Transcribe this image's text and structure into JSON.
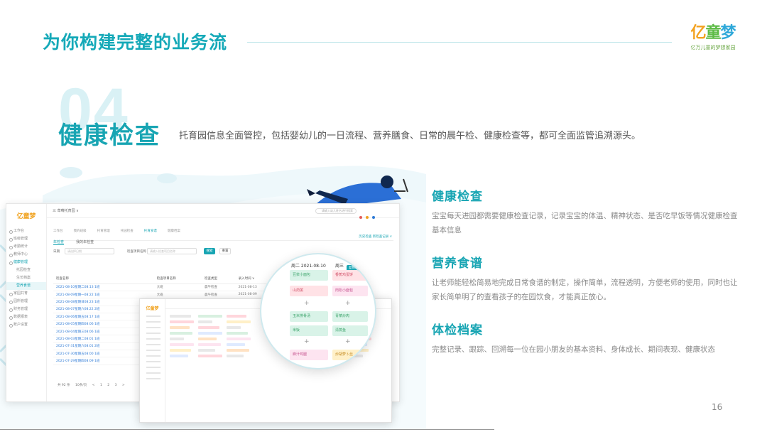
{
  "header": {
    "title": "为你构建完整的业务流",
    "logo": {
      "mark_part1": "亿",
      "mark_part2": "童",
      "mark_part3": "梦",
      "tagline": "亿万儿童的梦想家园"
    }
  },
  "section": {
    "number": "04",
    "title": "健康检查",
    "description": "托育园信息全面管控，包括婴幼儿的一日流程、营养膳食、日常的晨午检、健康检查等，都可全面监管追溯源头。"
  },
  "features": [
    {
      "title": "健康检查",
      "description": "宝宝每天进园都需要健康检查记录，记录宝宝的体温、精神状态、是否吃早饭等情况健康检查基本信息"
    },
    {
      "title": "营养食谱",
      "description": "让老师能轻松简易地完成日常食谱的制定，操作简单，流程透明，方便老师的使用，同时也让家长简单明了的查看孩子的在园饮食，才能真正放心。"
    },
    {
      "title": "体检档案",
      "description": "完整记录、跟踪、回溯每一位在园小朋友的基本资料、身体成长、期间表现、健康状态"
    }
  ],
  "page_number": "16",
  "mock_screen": {
    "logo": "亿童梦",
    "breadcrumb": "三 草莓托育园 ∨",
    "search_placeholder": "请输入幼儿姓名进行搜索",
    "sidebar": [
      "工作台",
      "班级管理",
      "考勤统计",
      "教师中心",
      "健康管理",
      "托园检查",
      "生长档案",
      "营养食谱",
      "家园共育",
      "园所管理",
      "财务管理",
      "数据报表",
      "账户设置"
    ],
    "top_tabs": [
      "工作台",
      "我的班级",
      "托育管理",
      "托园检查",
      "托育食谱",
      "健康档案"
    ],
    "sub_tabs": [
      "年检查",
      "我的年检查"
    ],
    "right_link": "历史检查  新检查记录 ∨",
    "filter": {
      "date_label": "日期",
      "date_placeholder": "请选择日期",
      "type_label": "检查项目名称",
      "type_placeholder": "请输入检查项目名称",
      "search_btn": "搜索",
      "reset_btn": "重置"
    },
    "table": {
      "headers": [
        "检查名称",
        "检查项目名称",
        "检查类型",
        "录入时间 ∨"
      ],
      "rows": [
        [
          "2021-08-10星期二08:13 1班",
          "大班",
          "晨午检查",
          "2021-08-13"
        ],
        [
          "2021-08-09星期一08:22 1班",
          "大班",
          "晨午检查",
          "2021-08-09"
        ],
        [
          "2021-08-08星期日08:23 1班",
          "小班",
          "晨午检查",
          "2021-08-08"
        ],
        [
          "2021-08-07星期六08:22 2班",
          "托班",
          "晨午检查",
          "2021-08-07"
        ],
        [
          "2021-08-06星期五08:17 1班",
          "中班",
          "晨午检查",
          "2021-08-06"
        ],
        [
          "2021-08-05星期四08:06 1班",
          "小班",
          "晨午检查",
          "2021-08-05"
        ],
        [
          "2021-08-04星期三08:06 1班",
          "大班",
          "晨午检查",
          "2021-08-04"
        ],
        [
          "2021-08-03星期二08:01 1班",
          "大班",
          "晨午检查",
          "2021-08-03"
        ],
        [
          "2021-07-31星期六08:01 2班",
          "小班",
          "晨午检查",
          "2021-07-31"
        ],
        [
          "2021-07-30星期五08:00 1班",
          "托班",
          "晨午检查",
          "2021-07-30"
        ],
        [
          "2021-07-29星期四08:09 1班",
          "托班",
          "晨午检查",
          "2021-07-29"
        ]
      ]
    },
    "pagination": [
      "共 92 条",
      "10条/页",
      "<",
      "1",
      "2",
      "3",
      ">"
    ]
  },
  "magnifier": {
    "col1_date": "周二 2021-08-10",
    "col2_date": "周三",
    "btn1": "复制食谱",
    "btn2": "+ 添加食谱",
    "cells": [
      "豆浆小面包",
      "香蕉鸡蛋饼",
      "山药粥",
      "肉松小面包",
      "玉米排骨汤",
      "青菜炒肉",
      "米饭",
      "清蒸鱼",
      "麻汁鸡腿",
      "炒胡萝卜丝"
    ]
  },
  "colors": {
    "accent": "#18a5b3",
    "title": "#15a9b8",
    "muted": "#8a8a8a"
  }
}
